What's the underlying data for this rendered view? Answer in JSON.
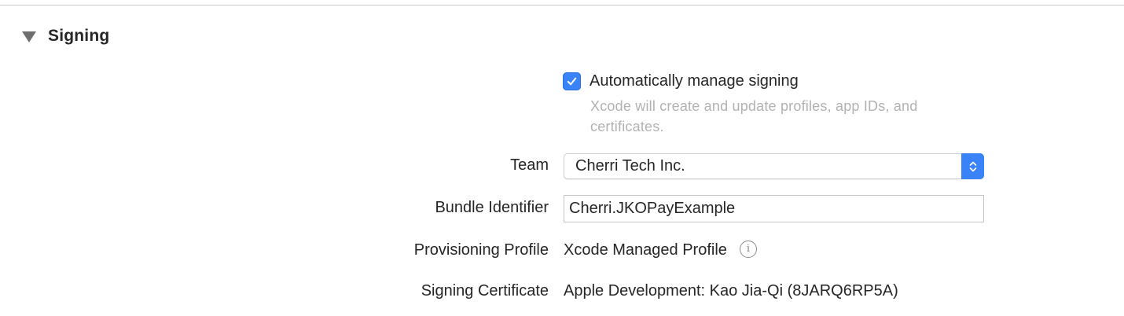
{
  "section": {
    "title": "Signing",
    "expanded": true
  },
  "auto_manage": {
    "label": "Automatically manage signing",
    "checked": true,
    "description": "Xcode will create and update profiles, app IDs, and certificates."
  },
  "team": {
    "label": "Team",
    "value": "Cherri Tech Inc."
  },
  "bundle_identifier": {
    "label": "Bundle Identifier",
    "value": "Cherri.JKOPayExample"
  },
  "provisioning_profile": {
    "label": "Provisioning Profile",
    "value": "Xcode Managed Profile",
    "info_icon": "info-circle-icon"
  },
  "signing_certificate": {
    "label": "Signing Certificate",
    "value": "Apple Development: Kao Jia-Qi (8JARQ6RP5A)"
  },
  "colors": {
    "accent": "#3a82f7",
    "secondary_text": "#b2b2b2"
  }
}
